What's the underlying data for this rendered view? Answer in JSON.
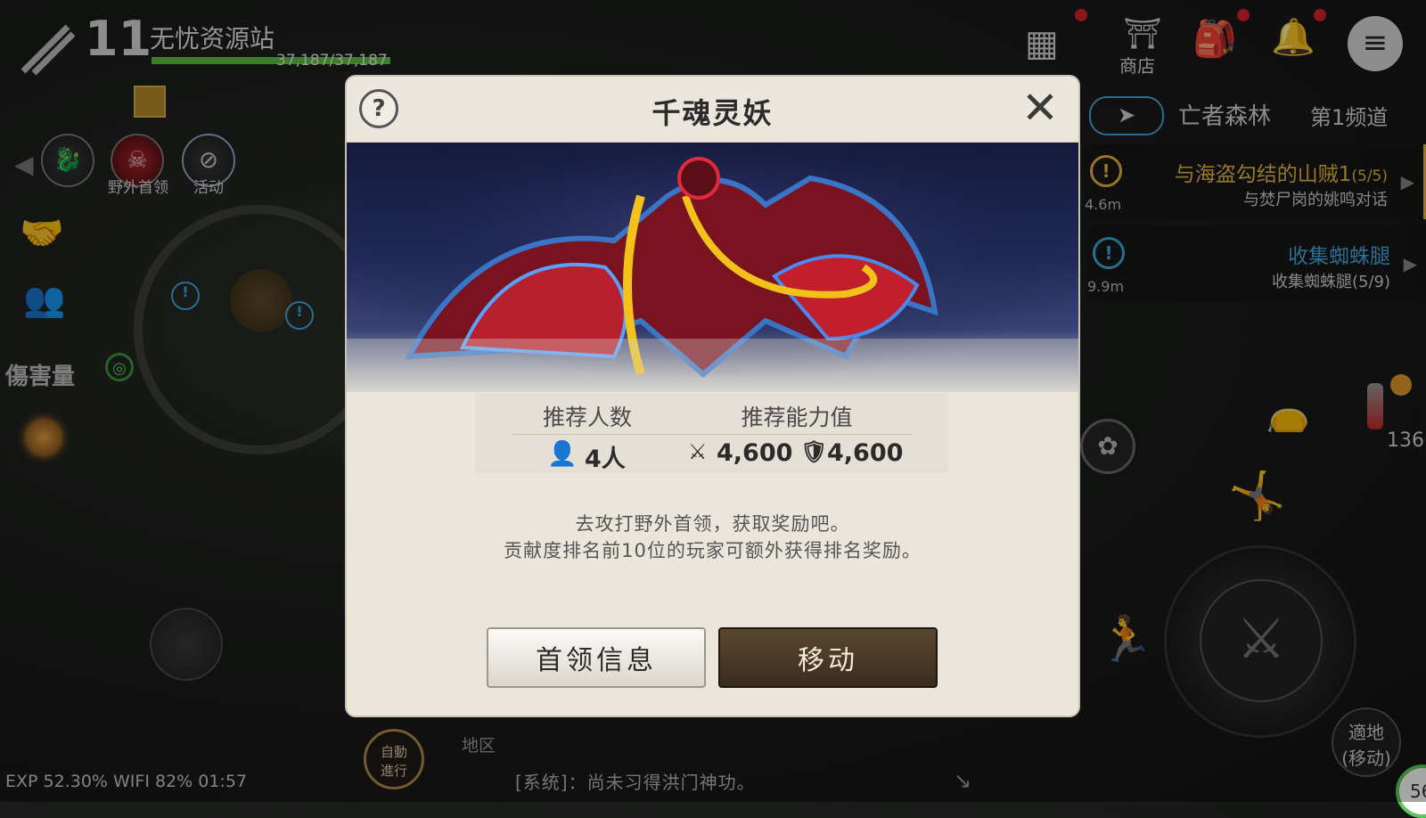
{
  "hud": {
    "level": "11",
    "player_name": "无忧资源站",
    "hp_text": "37,187/37,187",
    "hp_fraction": 1.0,
    "field_boss_label": "野外首领",
    "event_label": "活动",
    "damage_label": "傷害量"
  },
  "top_right": {
    "shop_label": "商店"
  },
  "location": {
    "zone": "亡者森林",
    "channel": "第1频道"
  },
  "quests": [
    {
      "title": "与海盗勾结的山贼1",
      "progress": "(5/5)",
      "sub": "与焚尸岗的姚鸣对话",
      "distance": "4.6m",
      "color": "#e8b73a"
    },
    {
      "title": "收集蜘蛛腿",
      "progress": "",
      "sub": "收集蜘蛛腿(5/9)",
      "distance": "9.9m",
      "color": "#3fa9e0"
    }
  ],
  "right_hud": {
    "potion_count": "136",
    "move_label_1": "適地",
    "move_label_2": "(移动)",
    "corner_number": "56"
  },
  "modal": {
    "title": "千魂灵妖",
    "stat_headers": [
      "推荐人数",
      "推荐能力值"
    ],
    "recommended_players": "4人",
    "attack_power": "4,600",
    "defense_power": "4,600",
    "desc_line1": "去攻打野外首领，获取奖励吧。",
    "desc_line2": "贡献度排名前10位的玩家可额外获得排名奖励。",
    "btn_info": "首领信息",
    "btn_move": "移动"
  },
  "bottom": {
    "status": "EXP 52.30%   WIFI  82%  01:57",
    "region_label": "地区",
    "chat": "[系统]：尚未习得洪门神功。",
    "auto_label_1": "自動",
    "auto_label_2": "進行"
  },
  "colors": {
    "accent_gold": "#e8b73a",
    "accent_blue": "#3fa9e0",
    "hp_green": "#59c23a",
    "notification_red": "#d8232a",
    "button_dark": "#3a2c1d"
  }
}
